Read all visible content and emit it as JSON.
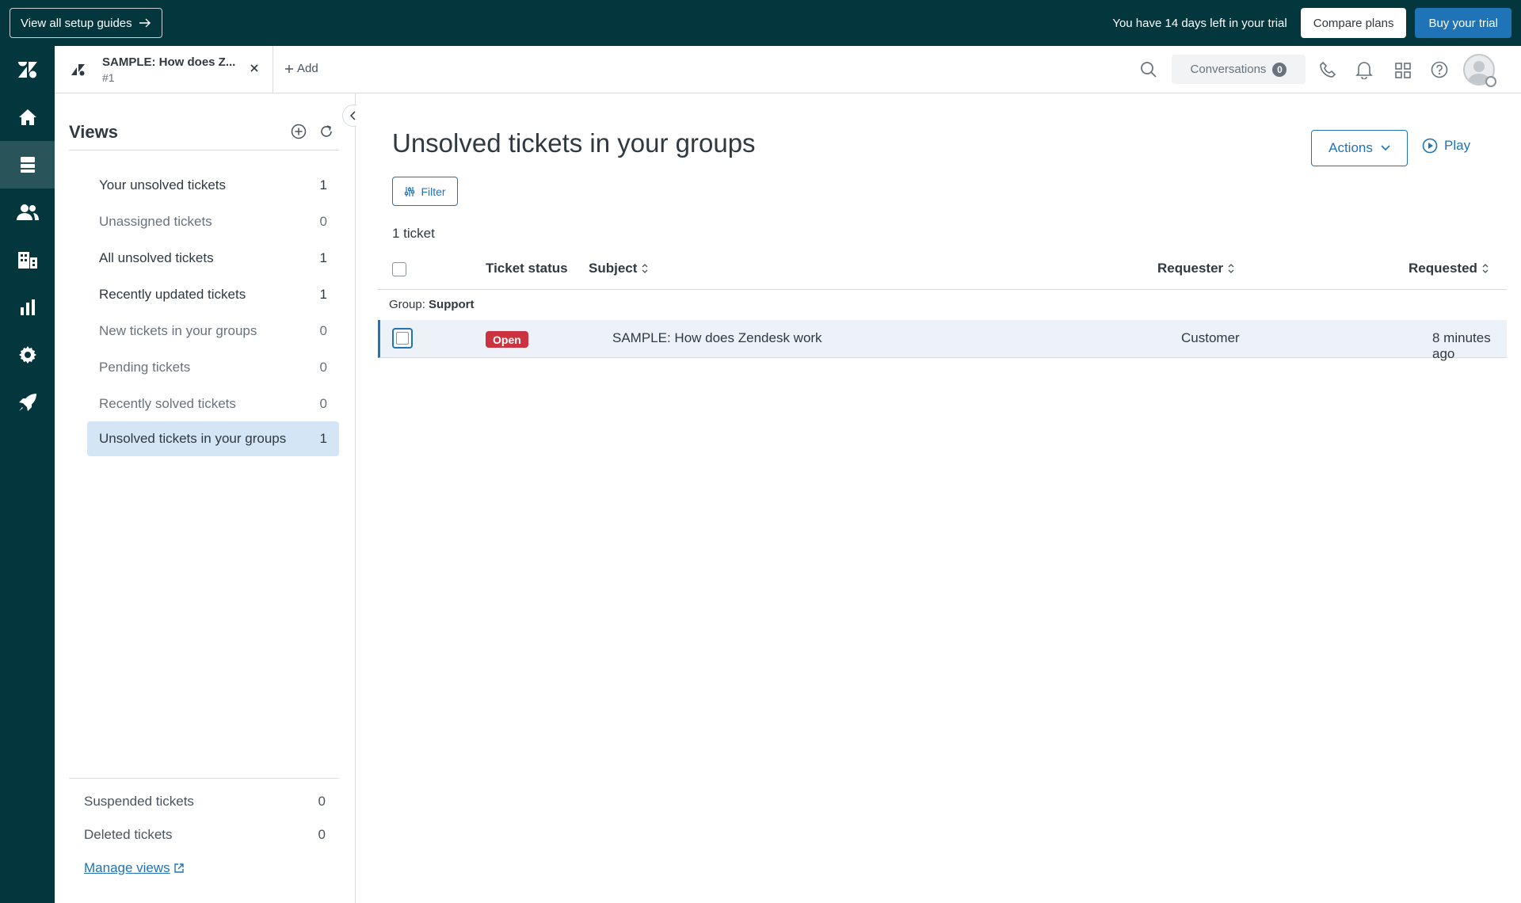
{
  "trial_bar": {
    "setup_label": "View all setup guides",
    "trial_text": "You have 14 days left in your trial",
    "compare_label": "Compare plans",
    "buy_label": "Buy your trial"
  },
  "rail": {
    "items": [
      "zendesk-logo",
      "home",
      "views",
      "customers",
      "organizations",
      "reporting",
      "admin",
      "getting-started"
    ],
    "active": "views"
  },
  "header": {
    "tab_title": "SAMPLE: How does Z...",
    "tab_sub": "#1",
    "add_label": "Add",
    "conversations_label": "Conversations",
    "conversations_count": "0"
  },
  "views": {
    "title": "Views",
    "items": [
      {
        "label": "Your unsolved tickets",
        "count": "1"
      },
      {
        "label": "Unassigned tickets",
        "count": "0"
      },
      {
        "label": "All unsolved tickets",
        "count": "1"
      },
      {
        "label": "Recently updated tickets",
        "count": "1"
      },
      {
        "label": "New tickets in your groups",
        "count": "0"
      },
      {
        "label": "Pending tickets",
        "count": "0"
      },
      {
        "label": "Recently solved tickets",
        "count": "0"
      },
      {
        "label": "Unsolved tickets in your groups",
        "count": "1"
      }
    ],
    "bottom": [
      {
        "label": "Suspended tickets",
        "count": "0"
      },
      {
        "label": "Deleted tickets",
        "count": "0"
      }
    ],
    "manage_label": "Manage views"
  },
  "main": {
    "title": "Unsolved tickets in your groups",
    "actions_label": "Actions",
    "play_label": "Play",
    "filter_label": "Filter",
    "ticket_count": "1 ticket",
    "columns": {
      "status": "Ticket status",
      "subject": "Subject",
      "requester": "Requester",
      "requested": "Requested"
    },
    "group_prefix": "Group:",
    "group_name": "Support",
    "rows": [
      {
        "status": "Open",
        "subject": "SAMPLE: How does Zendesk work",
        "requester": "Customer",
        "requested": "8 minutes ago"
      }
    ]
  },
  "colors": {
    "brand_dark": "#03363d",
    "accent": "#1f73b7",
    "open_status": "#cc3340",
    "selected_view": "#d4e5f5"
  }
}
